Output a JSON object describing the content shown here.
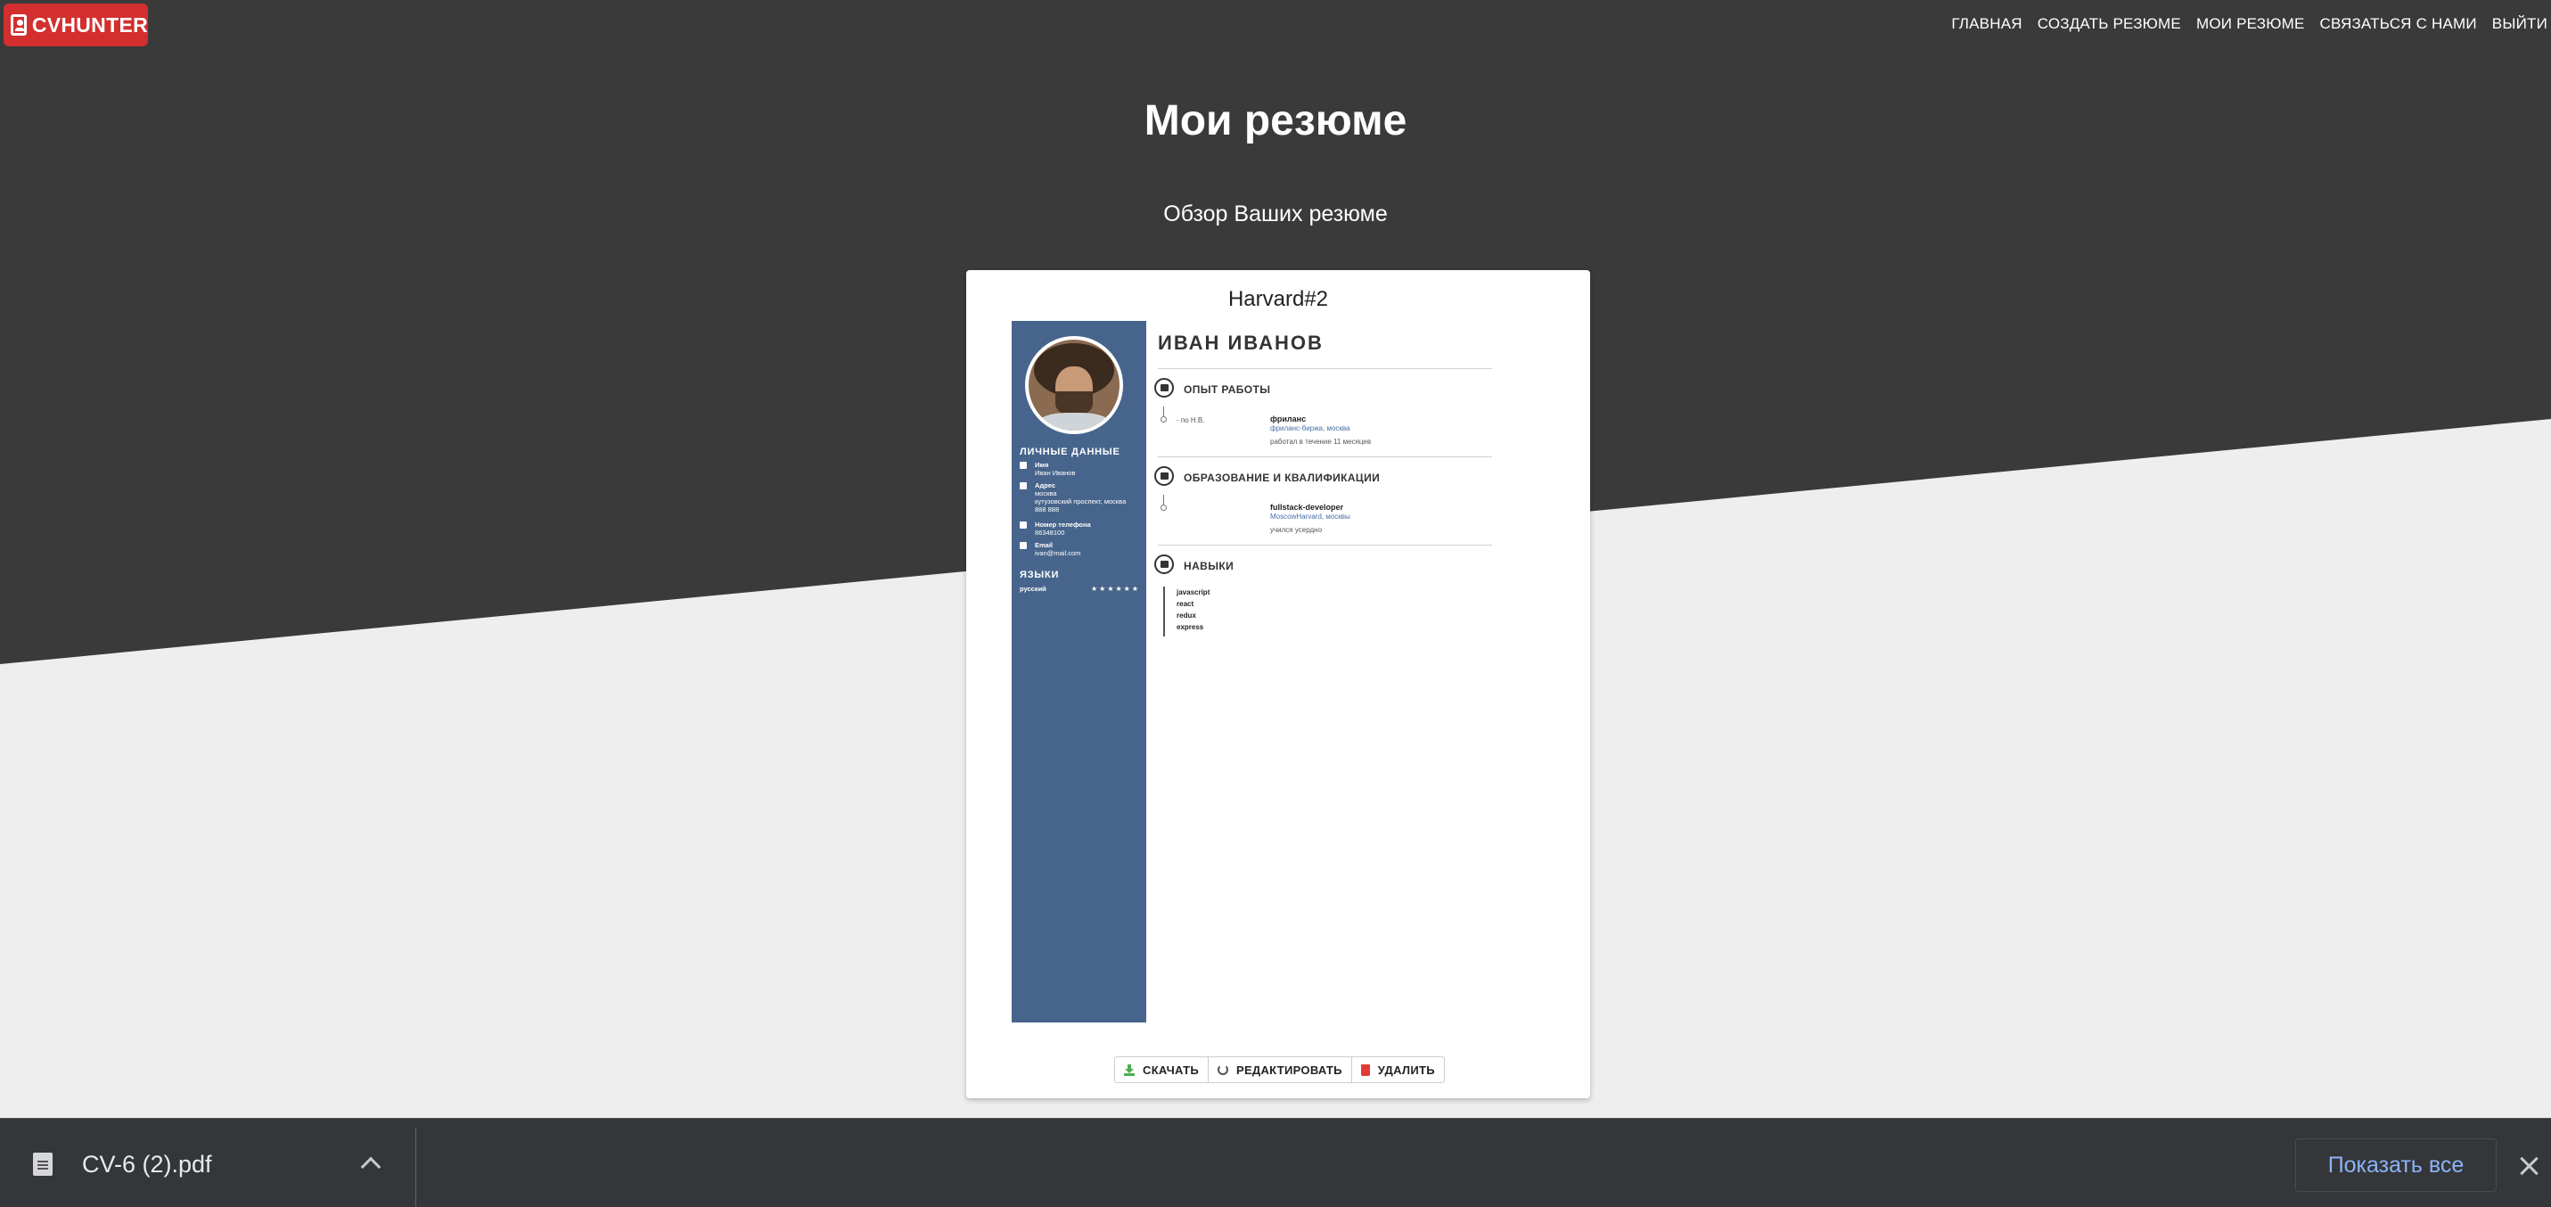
{
  "app": {
    "logo_text": "CVHUNTER"
  },
  "nav": {
    "items": [
      "ГЛАВНАЯ",
      "СОЗДАТЬ РЕЗЮМЕ",
      "МОИ РЕЗЮМЕ",
      "СВЯЗАТЬСЯ С НАМИ",
      "ВЫЙТИ"
    ]
  },
  "page": {
    "title": "Мои резюме",
    "subtitle": "Обзор Ваших резюме"
  },
  "card": {
    "title": "Harvard#2",
    "resume": {
      "name": "ИВАН ИВАНОВ",
      "personal_heading": "ЛИЧНЫЕ ДАННЫЕ",
      "personal": [
        {
          "icon": "person-icon",
          "label": "Имя",
          "value": "Иван Иванов"
        },
        {
          "icon": "home-icon",
          "label": "Адрес",
          "value": "москва\nкутузовский проспект, москва\n888 888"
        },
        {
          "icon": "phone-icon",
          "label": "Номер телефона",
          "value": "86348100"
        },
        {
          "icon": "email-icon",
          "label": "Email",
          "value": "ivan@mail.com"
        }
      ],
      "languages_heading": "ЯЗЫКИ",
      "languages": [
        {
          "name": "русский",
          "stars": "★★★★★★"
        }
      ],
      "experience_heading": "ОПЫТ РАБОТЫ",
      "experience": [
        {
          "date": "- по Н.В.",
          "title": "фриланс",
          "place": "фриланс-биржа, москва",
          "desc": "работал в течение 11 месяцев"
        }
      ],
      "education_heading": "ОБРАЗОВАНИЕ И КВАЛИФИКАЦИИ",
      "education": [
        {
          "title": "fullstack-developer",
          "place": "MoscowHarvard, москвы",
          "desc": "учился усердно"
        }
      ],
      "skills_heading": "НАВЫКИ",
      "skills": [
        "javascript",
        "react",
        "redux",
        "express"
      ]
    },
    "actions": {
      "download": "СКАЧАТЬ",
      "edit": "РЕДАКТИРОВАТЬ",
      "delete": "УДАЛИТЬ"
    }
  },
  "download_bar": {
    "file_name": "CV-6 (2).pdf",
    "show_all": "Показать все"
  }
}
